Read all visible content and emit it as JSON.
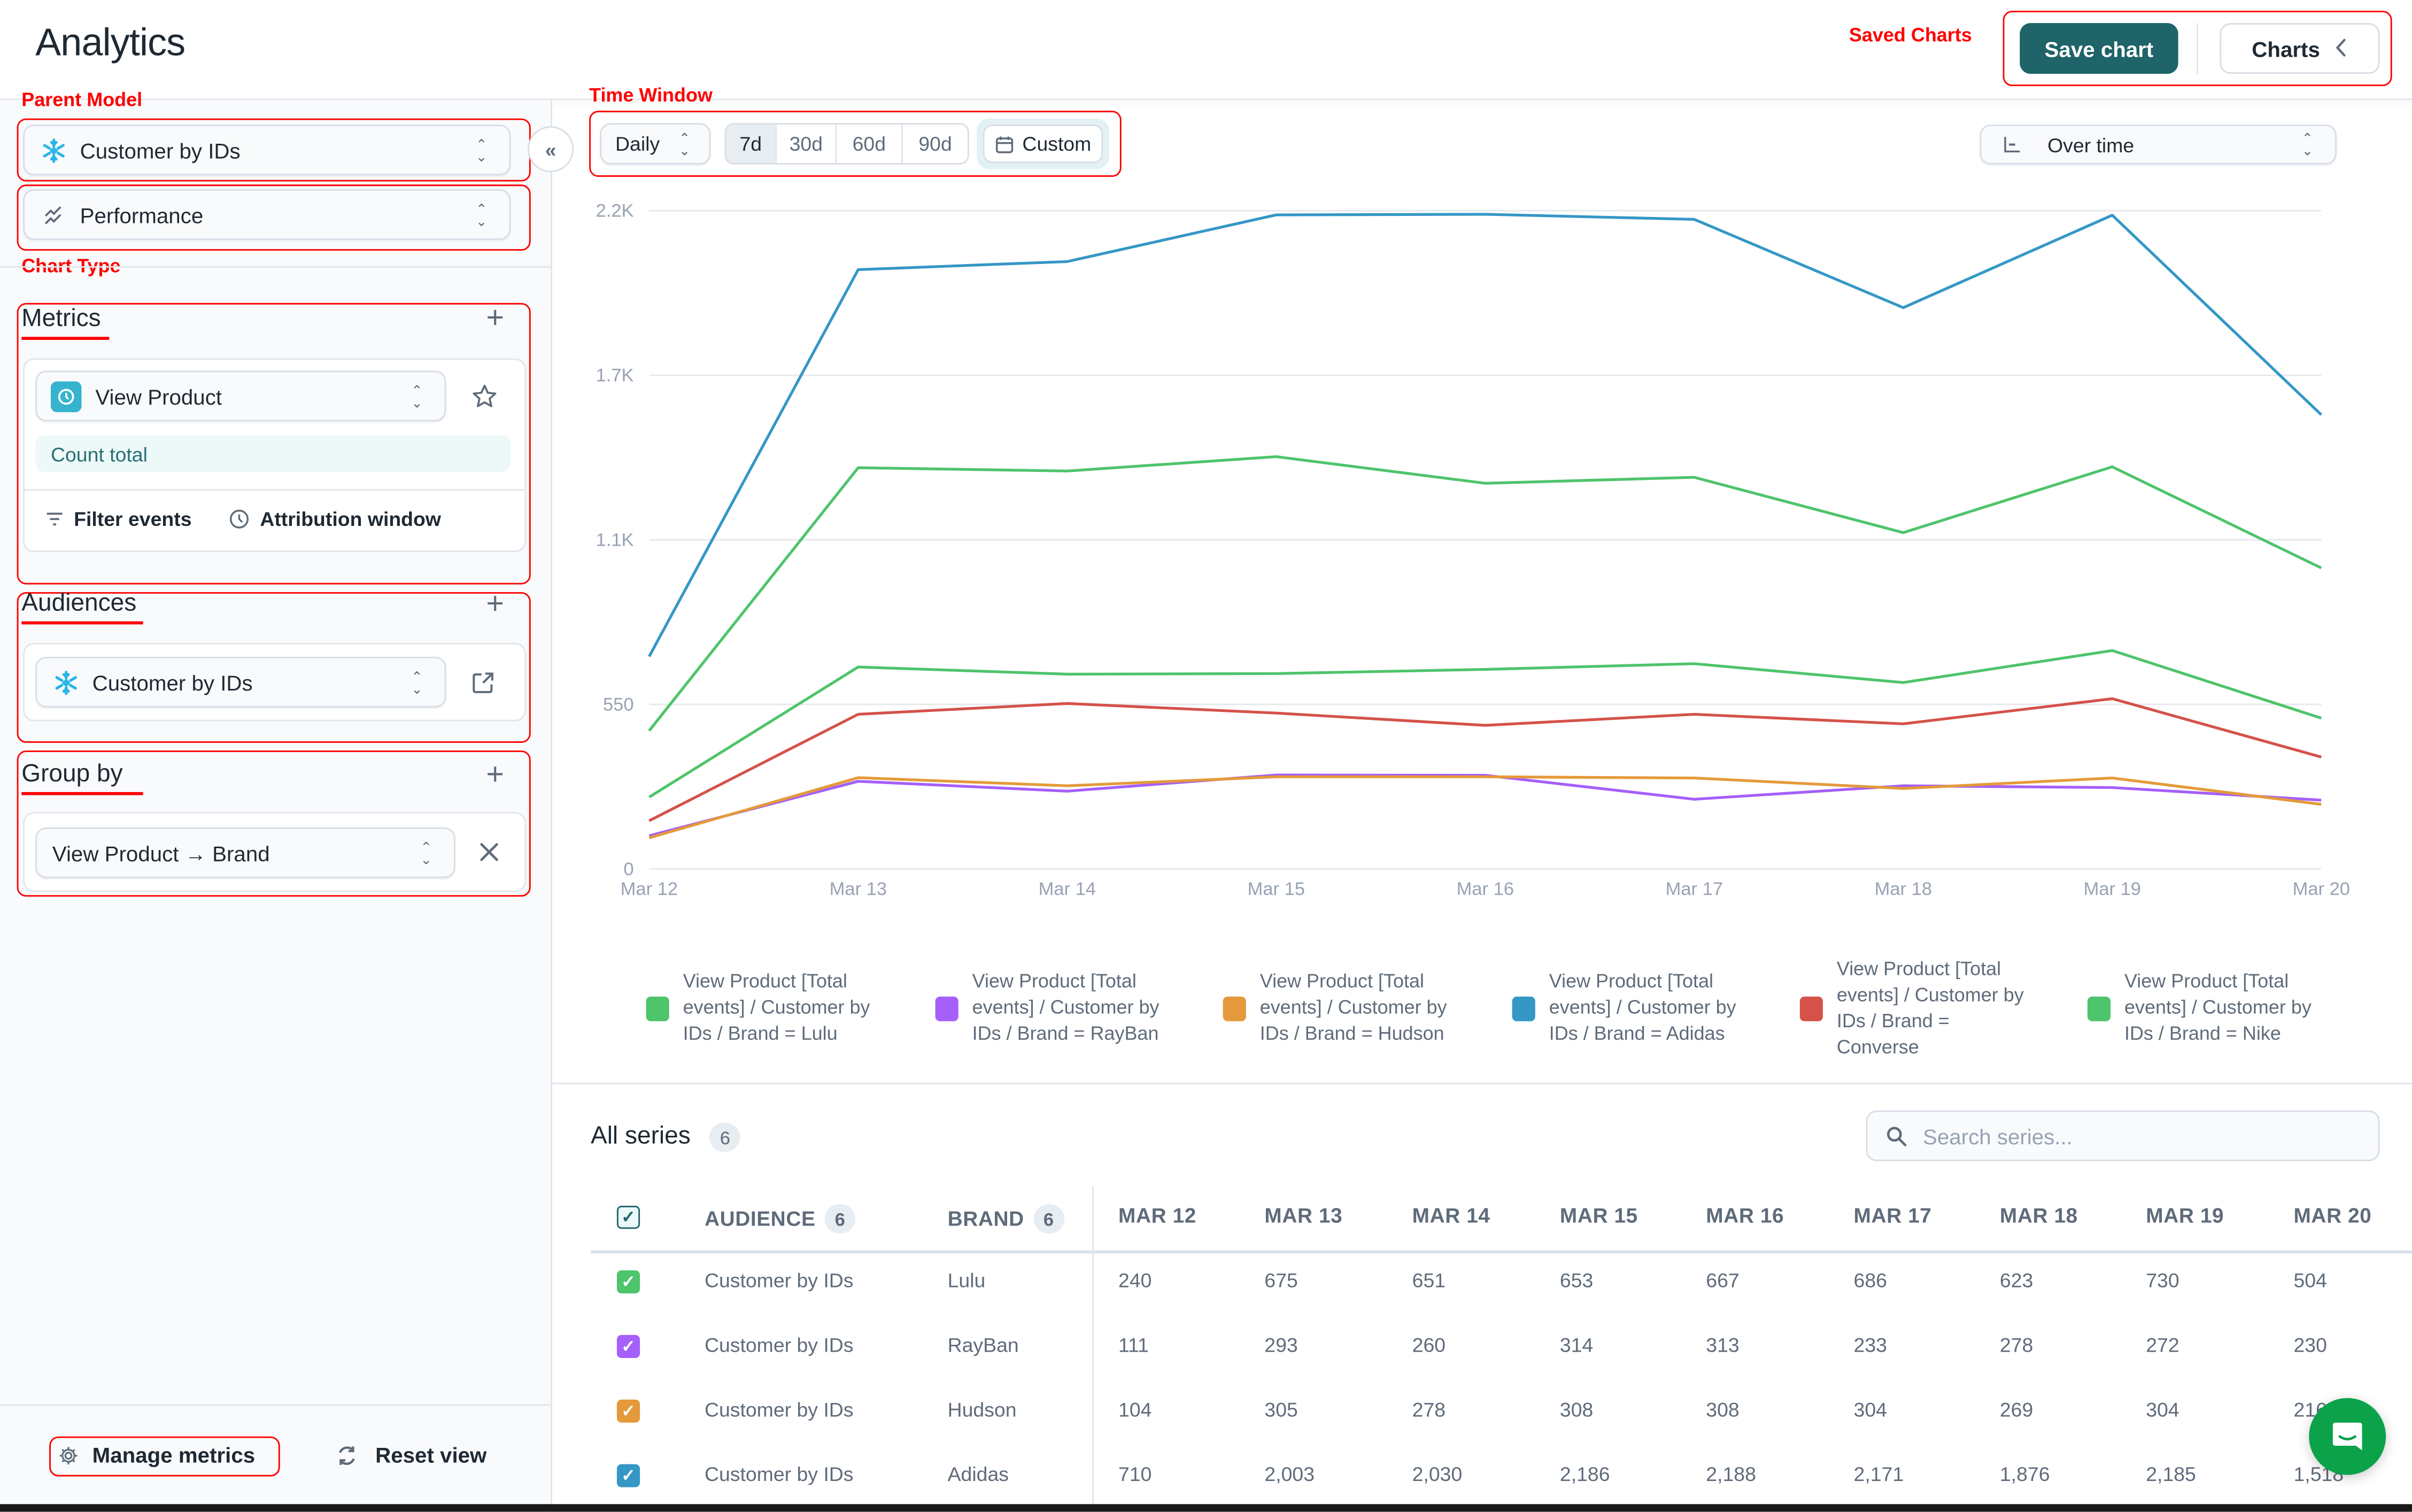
{
  "header": {
    "title": "Analytics",
    "save_chart_label": "Save chart",
    "charts_label": "Charts"
  },
  "annotations": {
    "parent_model": "Parent Model",
    "chart_type": "Chart Type",
    "time_window": "Time Window",
    "saved_charts": "Saved Charts"
  },
  "sidebar": {
    "parent_model_value": "Customer by IDs",
    "chart_type_value": "Performance",
    "metrics": {
      "title": "Metrics",
      "event_value": "View Product",
      "aggregation": "Count total",
      "filter_events_label": "Filter events",
      "attribution_window_label": "Attribution window"
    },
    "audiences": {
      "title": "Audiences",
      "value": "Customer by IDs"
    },
    "group_by": {
      "title": "Group by",
      "value": "View Product → Brand"
    },
    "footer": {
      "manage_metrics_label": "Manage metrics",
      "reset_view_label": "Reset view"
    }
  },
  "toolbar": {
    "granularity_value": "Daily",
    "ranges": [
      "7d",
      "30d",
      "60d",
      "90d"
    ],
    "active_range": "7d",
    "custom_label": "Custom",
    "view_mode_value": "Over time"
  },
  "chart_data": {
    "type": "line",
    "title": "",
    "xlabel": "",
    "ylabel": "",
    "x": [
      "Mar 12",
      "Mar 13",
      "Mar 14",
      "Mar 15",
      "Mar 16",
      "Mar 17",
      "Mar 18",
      "Mar 19",
      "Mar 20"
    ],
    "ylim": [
      0,
      2200
    ],
    "yticks": [
      0,
      550,
      1100,
      1650,
      2200
    ],
    "ytick_labels": [
      "0",
      "550",
      "1.1K",
      "1.7K",
      "2.2K"
    ],
    "grid": true,
    "legend_position": "bottom",
    "series": [
      {
        "name": "View Product [Total events] / Customer by IDs / Brand = Lulu",
        "color": "#4ec46b",
        "values": [
          240,
          675,
          651,
          653,
          667,
          686,
          623,
          730,
          504
        ]
      },
      {
        "name": "View Product [Total events] / Customer by IDs / Brand = RayBan",
        "color": "#a55ffa",
        "values": [
          111,
          293,
          260,
          314,
          313,
          233,
          278,
          272,
          230
        ]
      },
      {
        "name": "View Product [Total events] / Customer by IDs / Brand = Hudson",
        "color": "#e49a3a",
        "values": [
          104,
          305,
          278,
          308,
          308,
          304,
          269,
          304,
          216
        ]
      },
      {
        "name": "View Product [Total events] / Customer by IDs / Brand = Adidas",
        "color": "#3497c6",
        "values": [
          710,
          2003,
          2030,
          2186,
          2188,
          2171,
          1876,
          2185,
          1518
        ]
      },
      {
        "name": "View Product [Total events] / Customer by IDs / Brand = Converse",
        "color": "#d4524a",
        "values": [
          161,
          517,
          553,
          521,
          480,
          517,
          485,
          569,
          374
        ]
      },
      {
        "name": "View Product [Total events] / Customer by IDs / Brand = Nike",
        "color": "#4ec46b",
        "values": [
          462,
          1341,
          1330,
          1378,
          1289,
          1309,
          1124,
          1344,
          1006
        ]
      }
    ]
  },
  "legend": [
    {
      "text": "View Product [Total events] / Customer by IDs / Brand = Lulu",
      "color": "#4ec46b"
    },
    {
      "text": "View Product [Total events] / Customer by IDs / Brand = RayBan",
      "color": "#a55ffa"
    },
    {
      "text": "View Product [Total events] / Customer by IDs / Brand = Hudson",
      "color": "#e49a3a"
    },
    {
      "text": "View Product [Total events] / Customer by IDs / Brand = Adidas",
      "color": "#3497c6"
    },
    {
      "text": "View Product [Total events] / Customer by IDs / Brand = Converse",
      "color": "#d4524a"
    },
    {
      "text": "View Product [Total events] / Customer by IDs / Brand = Nike",
      "color": "#4ec46b"
    }
  ],
  "series_table": {
    "title": "All series",
    "count": "6",
    "search_placeholder": "Search series...",
    "columns": {
      "audience": "AUDIENCE",
      "audience_count": "6",
      "brand": "BRAND",
      "brand_count": "6",
      "dates": [
        "MAR 12",
        "MAR 13",
        "MAR 14",
        "MAR 15",
        "MAR 16",
        "MAR 17",
        "MAR 18",
        "MAR 19",
        "MAR 20"
      ]
    },
    "rows": [
      {
        "audience": "Customer by IDs",
        "brand": "Lulu",
        "color": "#4ec46b",
        "checked": true,
        "values": [
          "240",
          "675",
          "651",
          "653",
          "667",
          "686",
          "623",
          "730",
          "504"
        ]
      },
      {
        "audience": "Customer by IDs",
        "brand": "RayBan",
        "color": "#a55ffa",
        "checked": true,
        "values": [
          "111",
          "293",
          "260",
          "314",
          "313",
          "233",
          "278",
          "272",
          "230"
        ]
      },
      {
        "audience": "Customer by IDs",
        "brand": "Hudson",
        "color": "#e49a3a",
        "checked": true,
        "values": [
          "104",
          "305",
          "278",
          "308",
          "308",
          "304",
          "269",
          "304",
          "216"
        ]
      },
      {
        "audience": "Customer by IDs",
        "brand": "Adidas",
        "color": "#3497c6",
        "checked": true,
        "values": [
          "710",
          "2,003",
          "2,030",
          "2,186",
          "2,188",
          "2,171",
          "1,876",
          "2,185",
          "1,518"
        ]
      }
    ]
  },
  "colors": {
    "primary": "#1e6469",
    "annotation": "#ff0000",
    "snowflake": "#29b5e8",
    "chat": "#0ba24a"
  }
}
